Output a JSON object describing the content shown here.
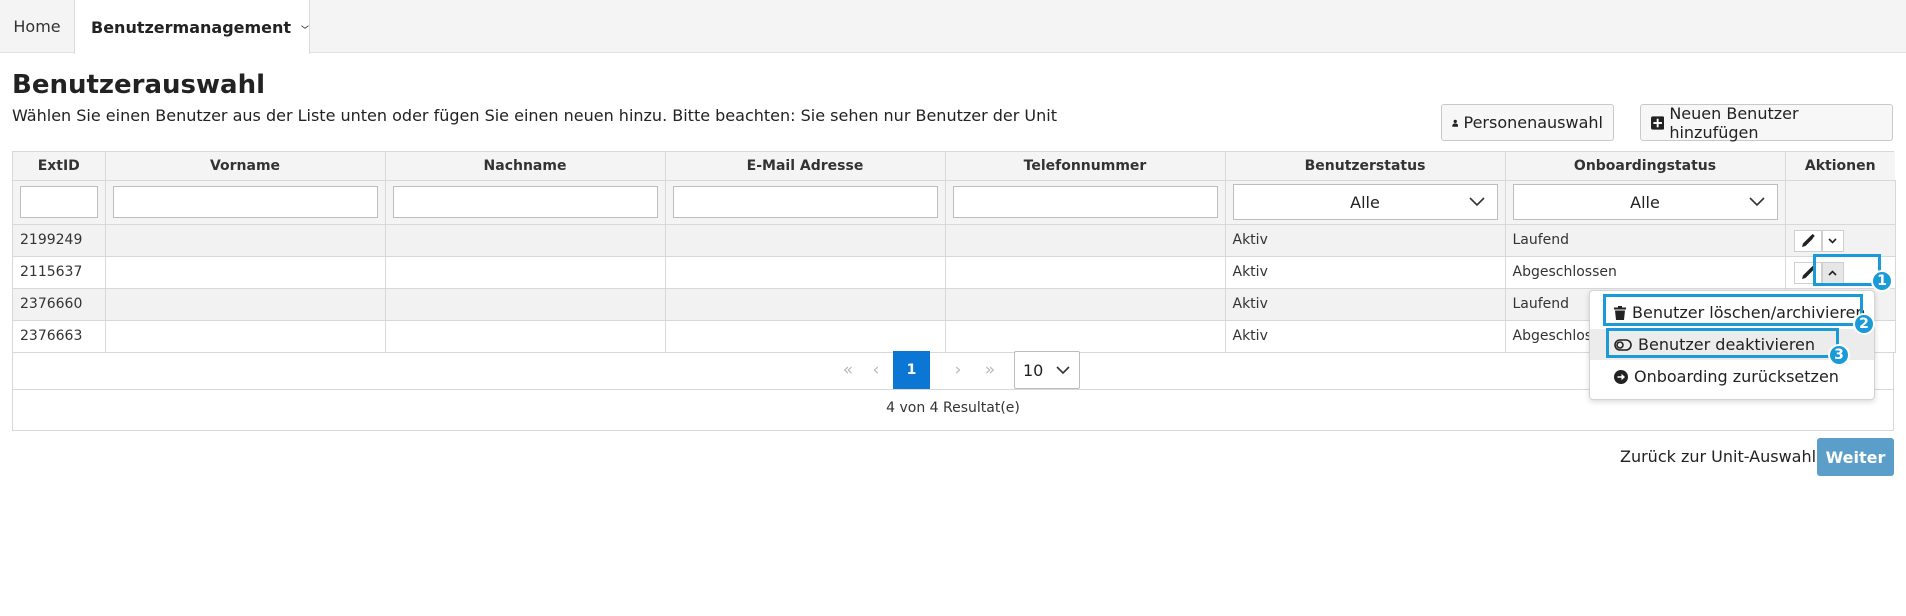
{
  "nav": {
    "home": "Home",
    "active_tab": "Benutzermanagement"
  },
  "header": {
    "title": "Benutzerauswahl",
    "description": "Wählen Sie einen Benutzer aus der Liste unten oder fügen Sie einen neuen hinzu. Bitte beachten: Sie sehen nur Benutzer der Unit",
    "person_button": "Personenauswahl",
    "new_user_button": "Neuen Benutzer hinzufügen"
  },
  "table": {
    "columns": [
      "ExtID",
      "Vorname",
      "Nachname",
      "E-Mail Adresse",
      "Telefonnummer",
      "Benutzerstatus",
      "Onboardingstatus",
      "Aktionen"
    ],
    "filters": {
      "benutzerstatus": "Alle",
      "onboardingstatus": "Alle"
    },
    "rows": [
      {
        "extid": "2199249",
        "vorname": "",
        "nachname": "",
        "email": "",
        "telefon": "",
        "status": "Aktiv",
        "onboarding": "Laufend"
      },
      {
        "extid": "2115637",
        "vorname": "",
        "nachname": "",
        "email": "",
        "telefon": "",
        "status": "Aktiv",
        "onboarding": "Abgeschlossen"
      },
      {
        "extid": "2376660",
        "vorname": "",
        "nachname": "",
        "email": "",
        "telefon": "",
        "status": "Aktiv",
        "onboarding": "Laufend"
      },
      {
        "extid": "2376663",
        "vorname": "",
        "nachname": "",
        "email": "",
        "telefon": "",
        "status": "Aktiv",
        "onboarding": "Abgeschlossen"
      }
    ]
  },
  "pagination": {
    "first": "«",
    "prev": "‹",
    "current_page": "1",
    "next": "›",
    "last": "»",
    "page_size": "10",
    "result_text": "4 von 4 Resultat(e)"
  },
  "footer": {
    "back_link": "Zurück zur Unit-Auswahl",
    "next_button": "Weiter"
  },
  "dropdown_menu": {
    "items": [
      "Benutzer löschen/archivieren",
      "Benutzer deaktivieren",
      "Onboarding zurücksetzen"
    ]
  },
  "annotations": {
    "badges": [
      "1",
      "2",
      "3"
    ],
    "highlight_color": "#1a9ad6"
  },
  "colors": {
    "primary": "#0b76d4",
    "next_button": "#5b9ec9"
  }
}
